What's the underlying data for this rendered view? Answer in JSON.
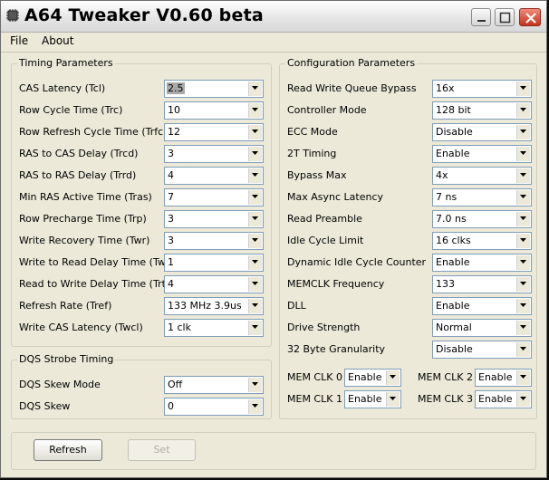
{
  "window": {
    "title": "A64 Tweaker V0.60 beta"
  },
  "menu": {
    "file": "File",
    "about": "About"
  },
  "timing": {
    "title": "Timing Parameters",
    "rows": [
      {
        "label": "CAS Latency (Tcl)",
        "value": "2.5",
        "highlighted": true
      },
      {
        "label": "Row Cycle Time (Trc)",
        "value": "10"
      },
      {
        "label": "Row Refresh Cycle Time (Trfc)",
        "value": "12"
      },
      {
        "label": "RAS to CAS Delay (Trcd)",
        "value": "3"
      },
      {
        "label": "RAS to RAS Delay (Trrd)",
        "value": "4"
      },
      {
        "label": "Min RAS Active Time (Tras)",
        "value": "7"
      },
      {
        "label": "Row Precharge Time (Trp)",
        "value": "3"
      },
      {
        "label": "Write Recovery Time (Twr)",
        "value": "3"
      },
      {
        "label": "Write to Read Delay Time (Twtr)",
        "value": "1"
      },
      {
        "label": "Read to Write Delay Time (Trtw)",
        "value": "4"
      },
      {
        "label": "Refresh Rate (Tref)",
        "value": "133 MHz 3.9us"
      },
      {
        "label": "Write CAS Latency (Twcl)",
        "value": "1 clk"
      }
    ]
  },
  "dqs": {
    "title": "DQS Strobe Timing",
    "rows": [
      {
        "label": "DQS Skew Mode",
        "value": "Off"
      },
      {
        "label": "DQS Skew",
        "value": "0"
      }
    ]
  },
  "config": {
    "title": "Configuration Parameters",
    "rows": [
      {
        "label": "Read Write Queue Bypass",
        "value": "16x"
      },
      {
        "label": "Controller Mode",
        "value": "128 bit"
      },
      {
        "label": "ECC Mode",
        "value": "Disable"
      },
      {
        "label": "2T Timing",
        "value": "Enable"
      },
      {
        "label": "Bypass Max",
        "value": "4x"
      },
      {
        "label": "Max Async Latency",
        "value": "7 ns"
      },
      {
        "label": "Read Preamble",
        "value": "7.0 ns"
      },
      {
        "label": "Idle Cycle Limit",
        "value": "16 clks"
      },
      {
        "label": "Dynamic Idle Cycle Counter",
        "value": "Enable"
      },
      {
        "label": "MEMCLK Frequency",
        "value": "133"
      },
      {
        "label": "DLL",
        "value": "Enable"
      },
      {
        "label": "Drive Strength",
        "value": "Normal"
      },
      {
        "label": "32 Byte Granularity",
        "value": "Disable"
      }
    ],
    "memclk": [
      {
        "label": "MEM CLK 0",
        "value": "Enable"
      },
      {
        "label": "MEM CLK 2",
        "value": "Enable"
      },
      {
        "label": "MEM CLK 1",
        "value": "Enable"
      },
      {
        "label": "MEM CLK 3",
        "value": "Enable"
      }
    ]
  },
  "buttons": {
    "refresh": "Refresh",
    "set": "Set"
  }
}
